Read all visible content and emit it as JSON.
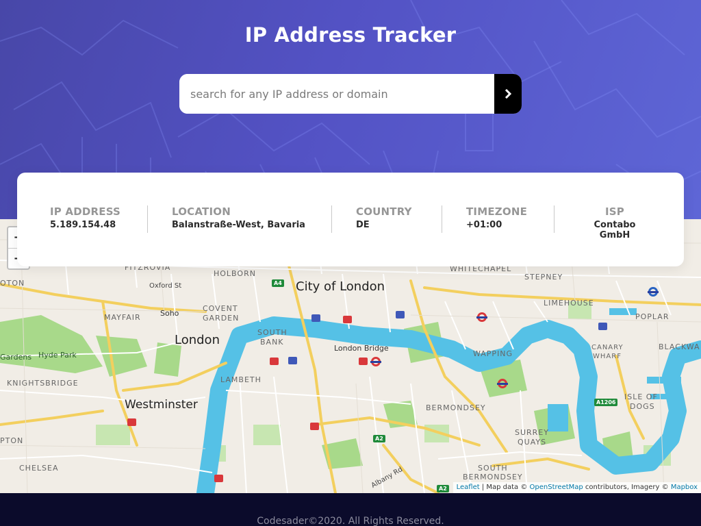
{
  "header": {
    "title": "IP Address Tracker",
    "search_placeholder": "search for any IP address or domain",
    "search_icon": "chevron-right-icon"
  },
  "info": {
    "ip": {
      "label": "IP ADDRESS",
      "value": "5.189.154.48"
    },
    "location": {
      "label": "LOCATION",
      "value": "Balanstraße-West, Bavaria"
    },
    "country": {
      "label": "COUNTRY",
      "value": "DE"
    },
    "timezone": {
      "label": "TIMEZONE",
      "value": "+01:00"
    },
    "isp": {
      "label": "ISP",
      "value": "Contabo GmbH"
    }
  },
  "map": {
    "zoom_in": "+",
    "zoom_out": "−",
    "labels": {
      "city_of_london": "City of London",
      "london": "London",
      "westminster": "Westminster",
      "fitzrovia": "FITZROVIA",
      "holborn": "HOLBORN",
      "whitechapel": "WHITECHAPEL",
      "stepney": "STEPNEY",
      "limehouse": "LIMEHOUSE",
      "poplar": "POPLAR",
      "blackwall": "BLACKWA",
      "oxford_st": "Oxford St",
      "soho": "Soho",
      "covent_garden_1": "COVENT",
      "covent_garden_2": "GARDEN",
      "mayfair": "MAYFAIR",
      "south_bank_1": "SOUTH",
      "south_bank_2": "BANK",
      "london_bridge": "London Bridge",
      "wapping": "WAPPING",
      "canary_wharf_1": "CANARY",
      "canary_wharf_2": "WHARF",
      "hyde_park": "Hyde Park",
      "gardens": "Gardens",
      "knightsbridge": "KNIGHTSBRIDGE",
      "lambeth": "LAMBETH",
      "bermondsey": "BERMONDSEY",
      "isle_of_dogs_1": "ISLE OF",
      "isle_of_dogs_2": "DOGS",
      "surrey_quays_1": "SURREY",
      "surrey_quays_2": "QUAYS",
      "south_bermondsey_1": "SOUTH",
      "south_bermondsey_2": "BERMONDSEY",
      "chelsea": "CHELSEA",
      "pton": "PTON",
      "oton": "OTON",
      "albany_rd": "Albany Rd"
    },
    "road_badges": {
      "a4": "A4",
      "a2_1": "A2",
      "a2_2": "A2",
      "a1206": "A1206"
    },
    "attribution": {
      "leaflet": "Leaflet",
      "sep": " | Map data © ",
      "osm": "OpenStreetMap",
      "mid": " contributors, Imagery © ",
      "mapbox": "Mapbox"
    }
  },
  "footer": {
    "text": "Codesader©2020. All Rights Reserved."
  },
  "colors": {
    "header_gradient_start": "#4847a8",
    "header_gradient_end": "#5e66d6",
    "search_button": "#000000",
    "label_gray": "#969696",
    "value_dark": "#2b2b2b",
    "footer_bg": "#0b0b2b",
    "river": "#55c1e6",
    "park": "#a8d98a"
  }
}
